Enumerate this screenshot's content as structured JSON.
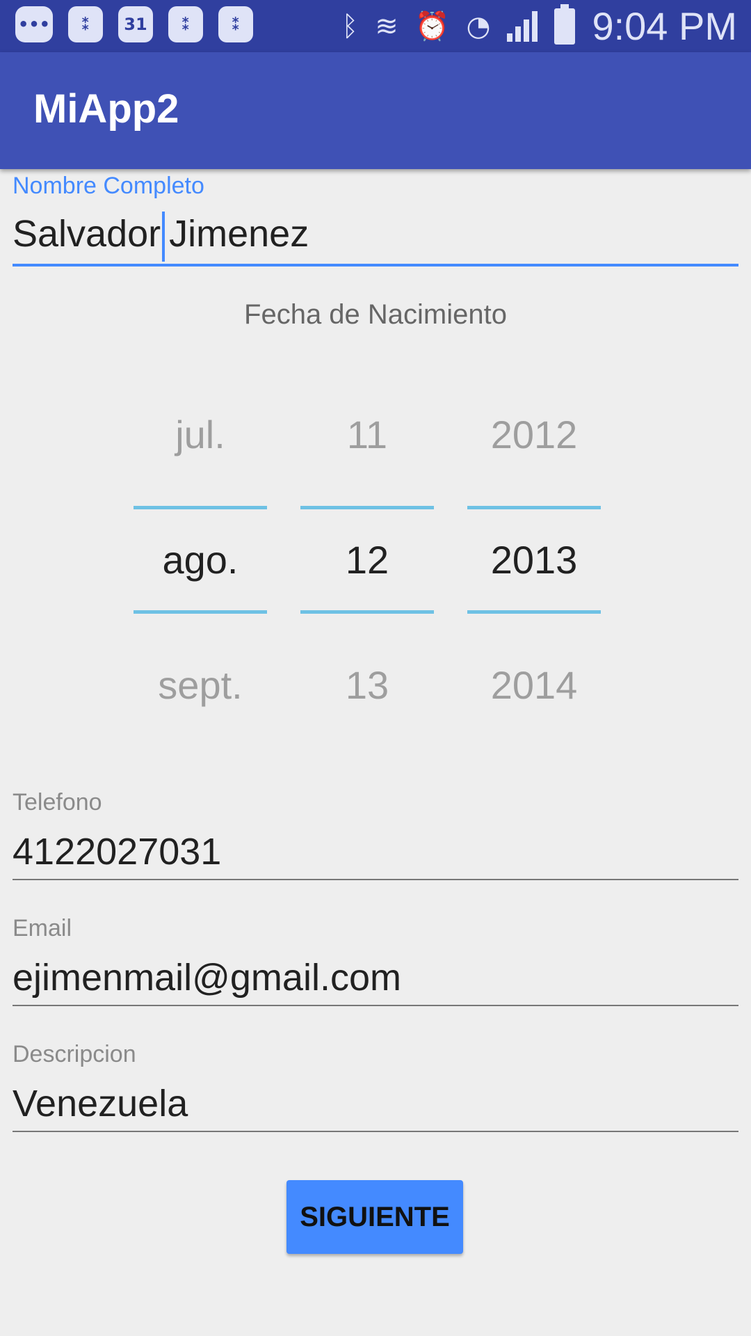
{
  "status_bar": {
    "time": "9:04 PM",
    "calendar_day": "31",
    "icons": [
      "messages-icon",
      "app-icon",
      "calendar-icon",
      "app-icon",
      "app-icon",
      "bluetooth-icon",
      "vibrate-icon",
      "alarm-icon",
      "wifi-icon",
      "signal-icon",
      "battery-charging-icon"
    ]
  },
  "app_bar": {
    "title": "MiApp2"
  },
  "form": {
    "nombre": {
      "label": "Nombre Completo",
      "value_before_cursor": "Salvador",
      "value_after_cursor": "Jimenez"
    },
    "fecha_label": "Fecha de Nacimiento",
    "date_picker": {
      "month": {
        "prev": "jul.",
        "selected": "ago.",
        "next": "sept."
      },
      "day": {
        "prev": "11",
        "selected": "12",
        "next": "13"
      },
      "year": {
        "prev": "2012",
        "selected": "2013",
        "next": "2014"
      }
    },
    "telefono": {
      "label": "Telefono",
      "value": "4122027031"
    },
    "email": {
      "label": "Email",
      "value": "ejimenmail@gmail.com"
    },
    "descripcion": {
      "label": "Descripcion",
      "value": "Venezuela"
    },
    "next_button": "SIGUIENTE"
  },
  "colors": {
    "status_bar": "#303f9f",
    "app_bar": "#3f51b5",
    "accent": "#448aff",
    "picker_divider": "#6ec1e4",
    "background": "#eeeeee"
  }
}
